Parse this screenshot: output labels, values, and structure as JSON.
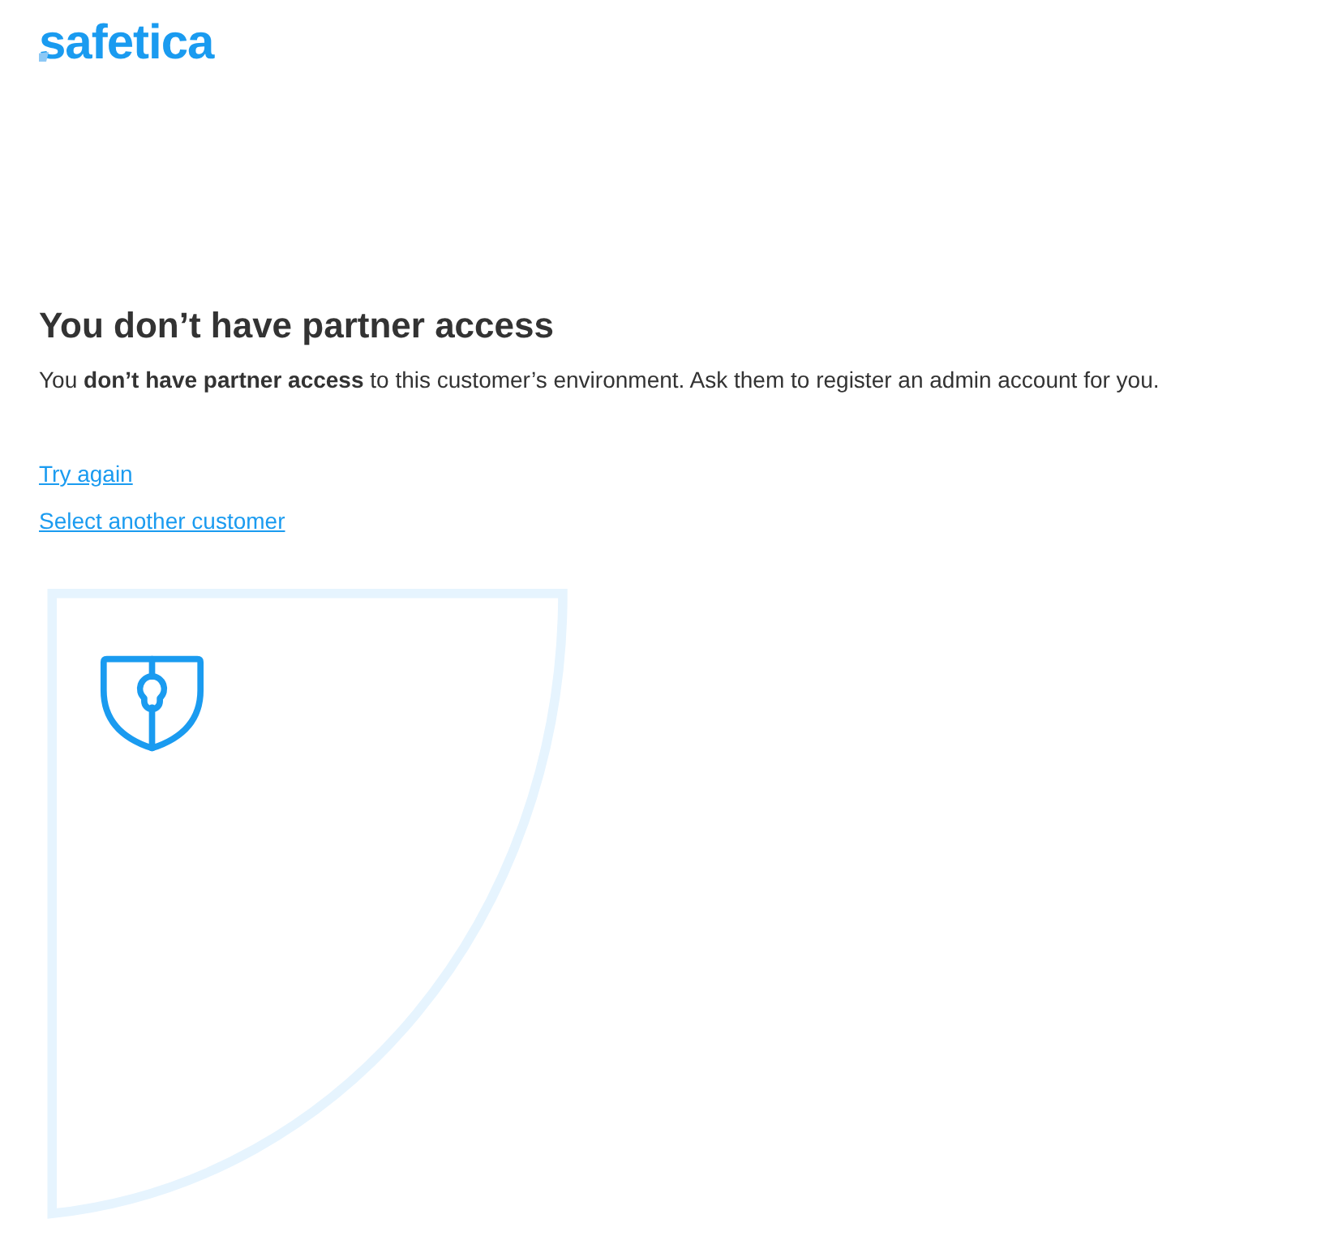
{
  "logo": {
    "text": "safetica"
  },
  "heading": "You don’t have partner access",
  "message": "You **don’t have partner access** to this customer’s environment. Ask them to register an admin account for you.",
  "links": [
    {
      "label": "Try again"
    },
    {
      "label": "Select another customer"
    }
  ]
}
